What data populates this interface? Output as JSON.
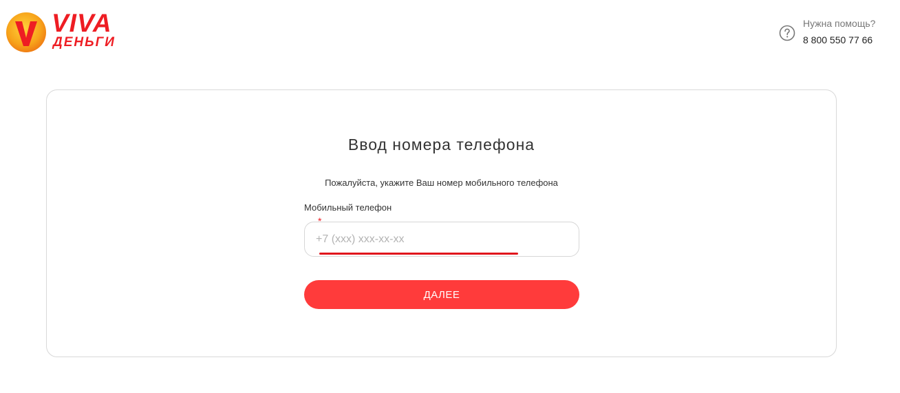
{
  "brand": {
    "word1": "VIVA",
    "word2": "ДЕНЬГИ",
    "color_primary": "#ee1d23",
    "color_mark_orange": "#f7a31a"
  },
  "help": {
    "icon": "question-circle-icon",
    "title": "Нужна помощь?",
    "phone": "8 800 550 77 66"
  },
  "form": {
    "title": "Ввод номера телефона",
    "subtitle": "Пожалуйста, укажите Ваш номер мобильного телефона",
    "phone_label": "Мобильный телефон",
    "required_mark": "*",
    "phone_placeholder": "+7 (xxx) xxx-xx-xx",
    "phone_value": "",
    "submit_label": "ДАЛЕЕ",
    "accent_color": "#ff3b3b"
  }
}
